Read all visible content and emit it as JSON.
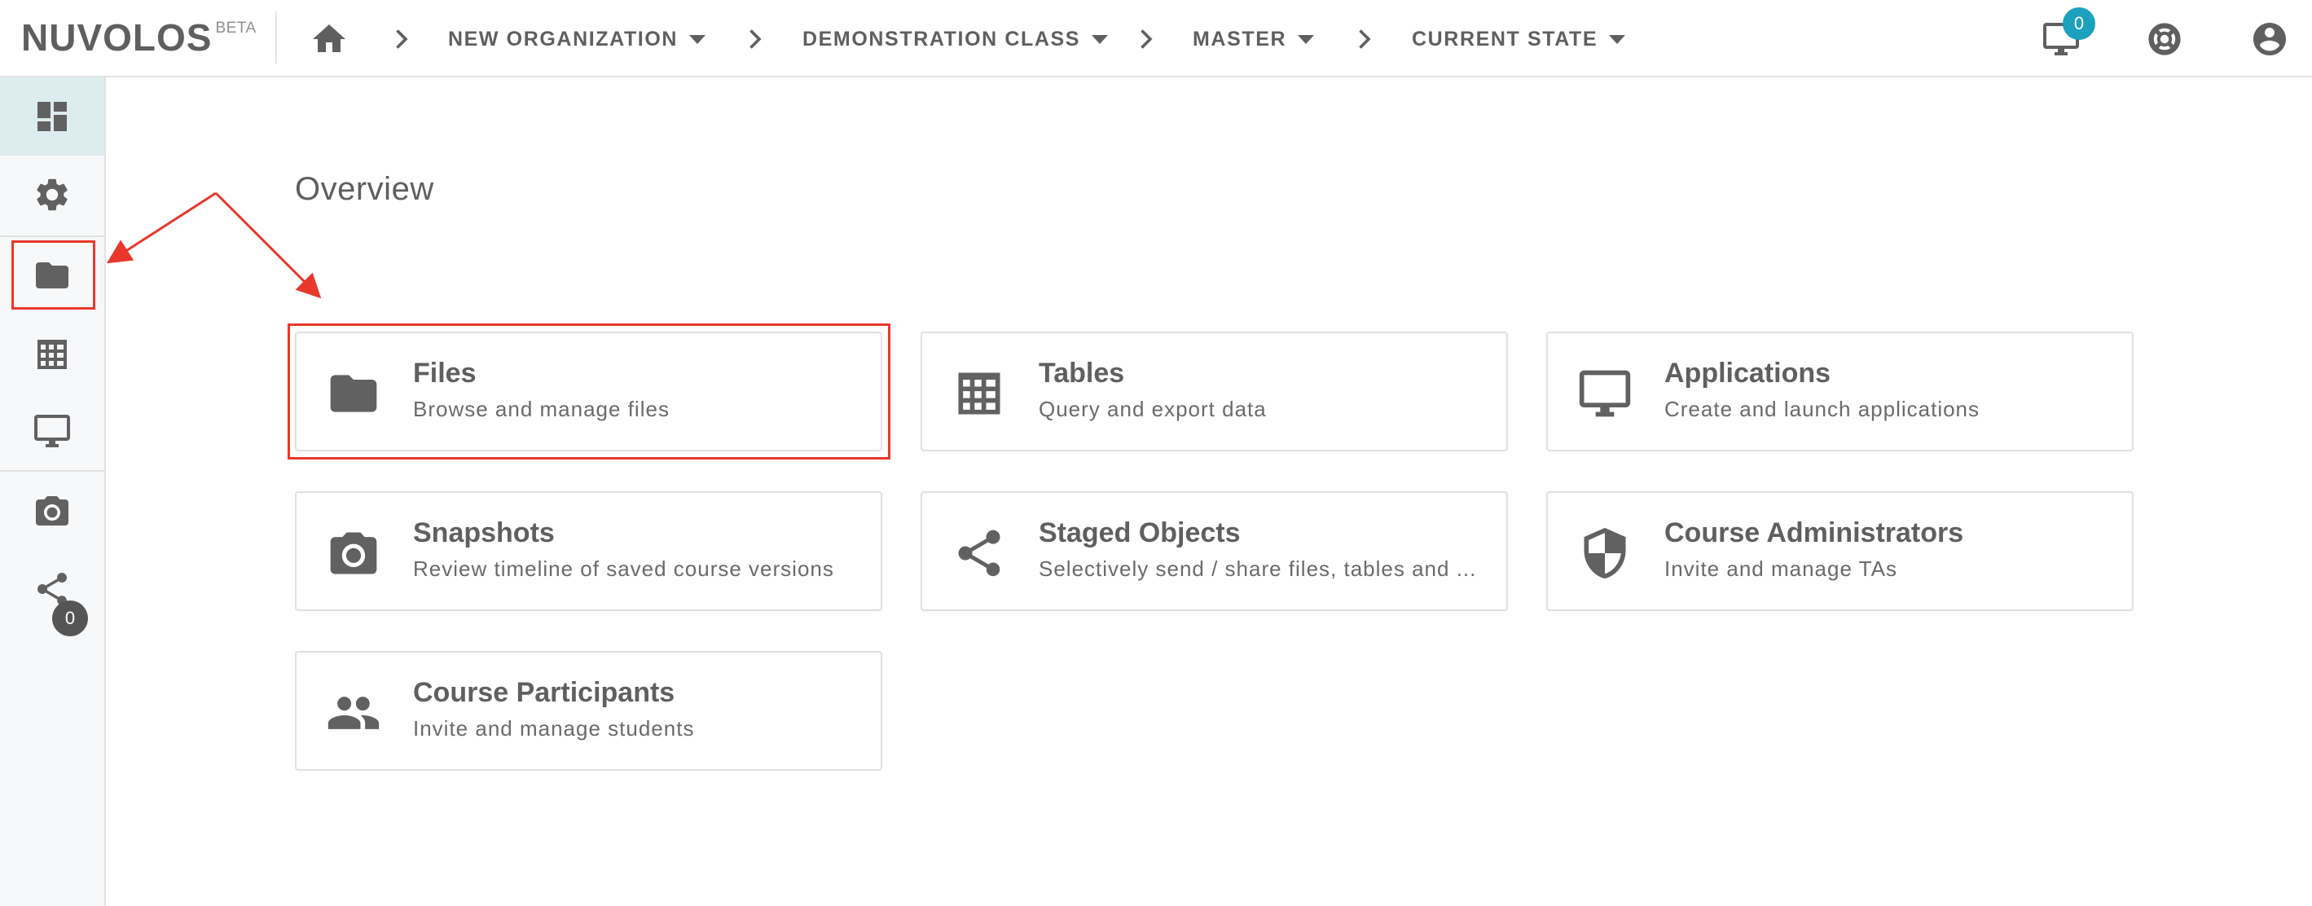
{
  "brand": {
    "name": "NUVOLOS",
    "tag": "BETA"
  },
  "breadcrumb": [
    {
      "label": "NEW ORGANIZATION"
    },
    {
      "label": "DEMONSTRATION CLASS"
    },
    {
      "label": "MASTER"
    },
    {
      "label": "CURRENT STATE"
    }
  ],
  "topbar": {
    "notifications_count": "0"
  },
  "sidebar": {
    "items": [
      {
        "icon": "dashboard-icon",
        "active": true
      },
      {
        "icon": "gear-icon"
      },
      {
        "icon": "folder-icon",
        "highlighted": true
      },
      {
        "icon": "table-icon"
      },
      {
        "icon": "monitor-icon"
      },
      {
        "icon": "camera-icon"
      },
      {
        "icon": "share-icon",
        "badge": "0"
      }
    ]
  },
  "main": {
    "title": "Overview",
    "cards": [
      {
        "title": "Files",
        "desc": "Browse and manage files",
        "icon": "folder-icon"
      },
      {
        "title": "Tables",
        "desc": "Query and export data",
        "icon": "table-icon"
      },
      {
        "title": "Applications",
        "desc": "Create and launch applications",
        "icon": "monitor-icon"
      },
      {
        "title": "Snapshots",
        "desc": "Review timeline of saved course versions",
        "icon": "camera-icon"
      },
      {
        "title": "Staged Objects",
        "desc": "Selectively send / share files, tables and ...",
        "icon": "share-icon"
      },
      {
        "title": "Course Administrators",
        "desc": "Invite and manage TAs",
        "icon": "shield-icon"
      },
      {
        "title": "Course Participants",
        "desc": "Invite and manage students",
        "icon": "people-icon"
      }
    ]
  },
  "colors": {
    "annotation": "#e8382c",
    "accent": "#1ba0be",
    "icon": "#616161",
    "active_bg": "#dcecef"
  }
}
